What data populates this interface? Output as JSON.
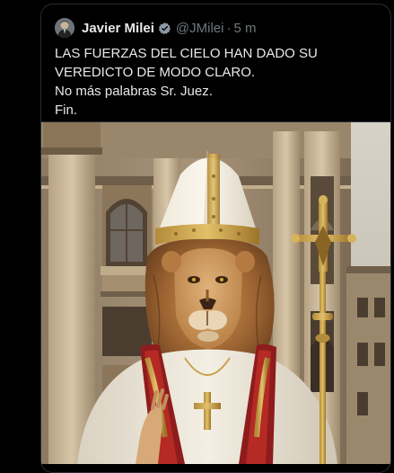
{
  "tweet": {
    "author_name": "Javier Milei",
    "handle": "@JMilei",
    "separator": "·",
    "time": "5 m",
    "verified": true,
    "text_lines": [
      "LAS FUERZAS DEL CIELO HAN DADO SU",
      "VEREDICTO DE MODO CLARO.",
      "No más palabras Sr. Juez.",
      "Fin."
    ],
    "media": {
      "icon": "lion-pope-image"
    }
  },
  "colors": {
    "background": "#000000",
    "text": "#e7e9ea",
    "muted": "#71767b",
    "verified": "#8b98a5"
  }
}
